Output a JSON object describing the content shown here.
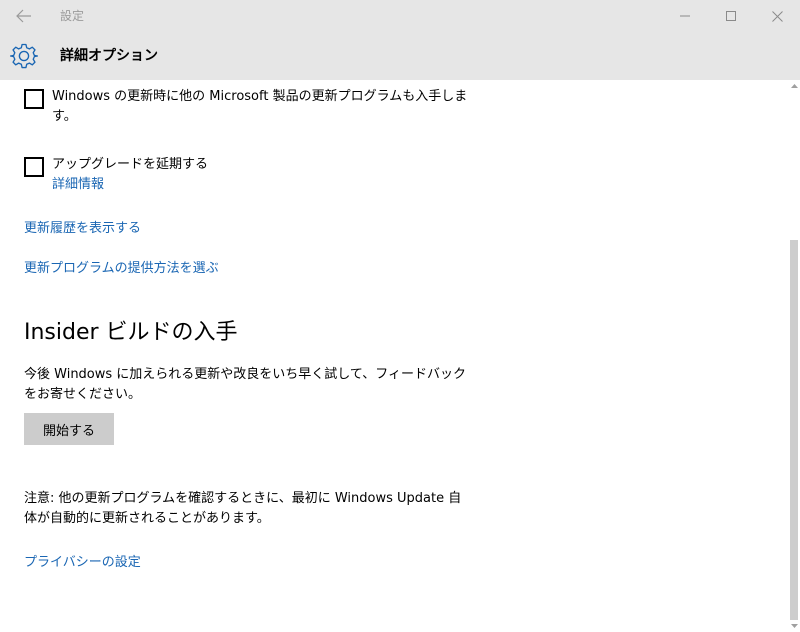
{
  "window": {
    "title": "設定"
  },
  "header": {
    "title": "詳細オプション",
    "icon": "gear-icon"
  },
  "options": [
    {
      "label": "Windows の更新時に他の Microsoft 製品の更新プログラムも入手します。",
      "checked": false
    },
    {
      "label": "アップグレードを延期する",
      "checked": false,
      "link": "詳細情報"
    }
  ],
  "links": {
    "history": "更新履歴を表示する",
    "delivery": "更新プログラムの提供方法を選ぶ"
  },
  "insider": {
    "heading": "Insider ビルドの入手",
    "description": "今後 Windows に加えられる更新や改良をいち早く試して、フィードバックをお寄せください。",
    "button": "開始する"
  },
  "note": "注意: 他の更新プログラムを確認するときに、最初に Windows Update 自体が自動的に更新されることがあります。",
  "privacy_link": "プライバシーの設定",
  "colors": {
    "accent": "#1a66b3",
    "titlebar": "#e6e6e6",
    "button": "#cccccc"
  }
}
